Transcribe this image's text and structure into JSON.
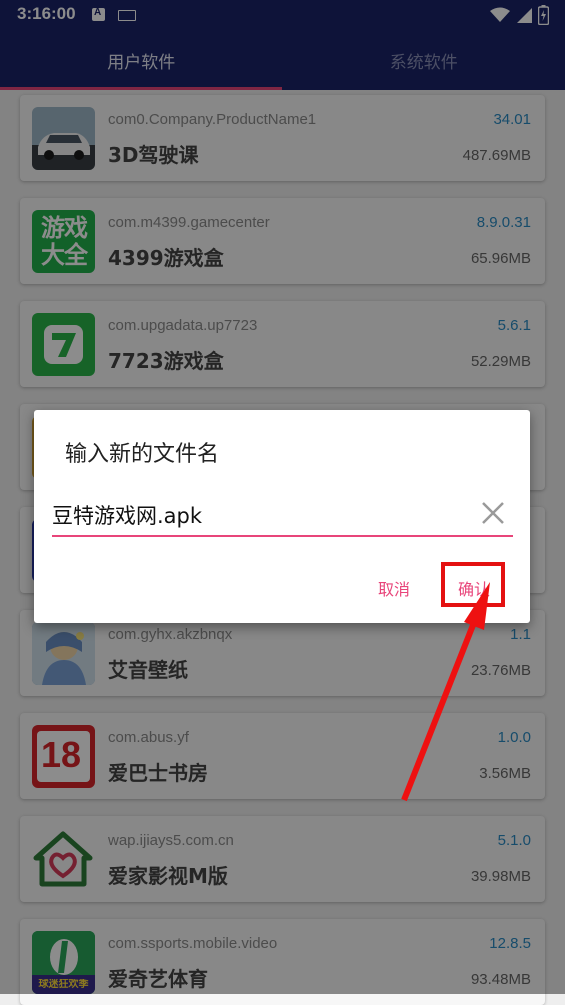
{
  "status_bar": {
    "time": "3:16:00"
  },
  "tabs": [
    {
      "label": "用户软件",
      "active": true
    },
    {
      "label": "系统软件",
      "active": false
    }
  ],
  "apps": [
    {
      "package": "com0.Company.ProductName1",
      "name": "3D驾驶课",
      "version": "34.01",
      "size": "487.69MB",
      "icon": "car-icon"
    },
    {
      "package": "com.m4399.gamecenter",
      "name": "4399游戏盒",
      "version": "8.9.0.31",
      "size": "65.96MB",
      "icon": "game-box-icon"
    },
    {
      "package": "com.upgadata.up7723",
      "name": "7723游戏盒",
      "version": "5.6.1",
      "size": "52.29MB",
      "icon": "seven-icon"
    },
    {
      "package": "",
      "name": "",
      "version": "",
      "size": "",
      "icon": "hidden-app-icon"
    },
    {
      "package": "",
      "name": "",
      "version": "",
      "size": "",
      "icon": "hidden-app-icon"
    },
    {
      "package": "com.gyhx.akzbnqx",
      "name": "艾音壁纸",
      "version": "1.1",
      "size": "23.76MB",
      "icon": "wallpaper-icon"
    },
    {
      "package": "com.abus.yf",
      "name": "爱巴士书房",
      "version": "1.0.0",
      "size": "3.56MB",
      "icon": "number-18-icon"
    },
    {
      "package": "wap.ijiays5.com.cn",
      "name": "爱家影视M版",
      "version": "5.1.0",
      "size": "39.98MB",
      "icon": "house-heart-icon"
    },
    {
      "package": "com.ssports.mobile.video",
      "name": "爱奇艺体育",
      "version": "12.8.5",
      "size": "93.48MB",
      "icon": "sports-icon"
    }
  ],
  "app_icon_texts": {
    "game_box": "游戏大全",
    "eighteen": "18",
    "sports": "球迷狂欢季"
  },
  "dialog": {
    "title": "输入新的文件名",
    "input_value": "豆特游戏网.apk",
    "cancel_label": "取消",
    "confirm_label": "确认"
  },
  "colors": {
    "primary": "#1a2368",
    "accent": "#e8457a",
    "highlight": "#e41111",
    "version": "#2a8bc4"
  }
}
